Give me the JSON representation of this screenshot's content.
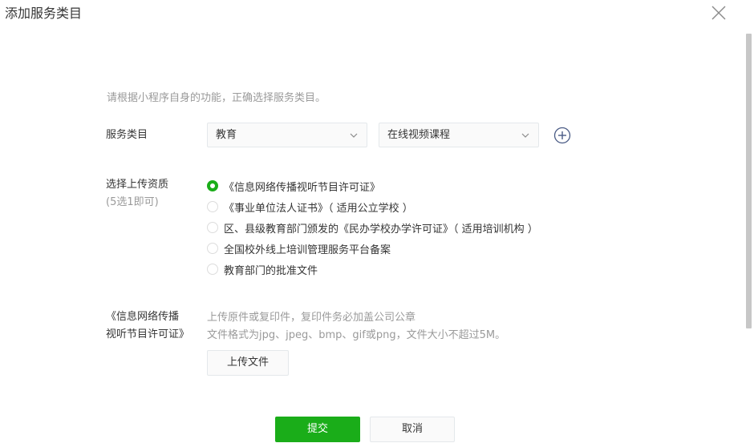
{
  "dialog": {
    "title": "添加服务类目",
    "close_icon": "close-icon"
  },
  "form": {
    "tip": "请根据小程序自身的功能，正确选择服务类目。",
    "category_label": "服务类目",
    "category_primary": "教育",
    "category_secondary": "在线视频课程",
    "add_icon": "plus-circle-icon",
    "qualification_label": "选择上传资质",
    "qualification_sublabel": "(5选1即可)",
    "qualification_options": [
      {
        "label": "《信息网络传播视听节目许可证》",
        "checked": true
      },
      {
        "label": "《事业单位法人证书》（ 适用公立学校 ）",
        "checked": false
      },
      {
        "label": "区、县级教育部门颁发的《民办学校办学许可证》（ 适用培训机构 ）",
        "checked": false
      },
      {
        "label": "全国校外线上培训管理服务平台备案",
        "checked": false
      },
      {
        "label": "教育部门的批准文件",
        "checked": false
      }
    ],
    "upload_label": "《信息网络传播视听节目许可证》",
    "upload_desc_1": "上传原件或复印件，复印件务必加盖公司公章",
    "upload_desc_2": "文件格式为jpg、jpeg、bmp、gif或png，文件大小不超过5M。",
    "upload_button": "上传文件"
  },
  "footer": {
    "submit": "提交",
    "cancel": "取消"
  },
  "colors": {
    "accent": "#1aad19",
    "muted_text": "#9a9a9a",
    "border": "#e4e8eb"
  }
}
